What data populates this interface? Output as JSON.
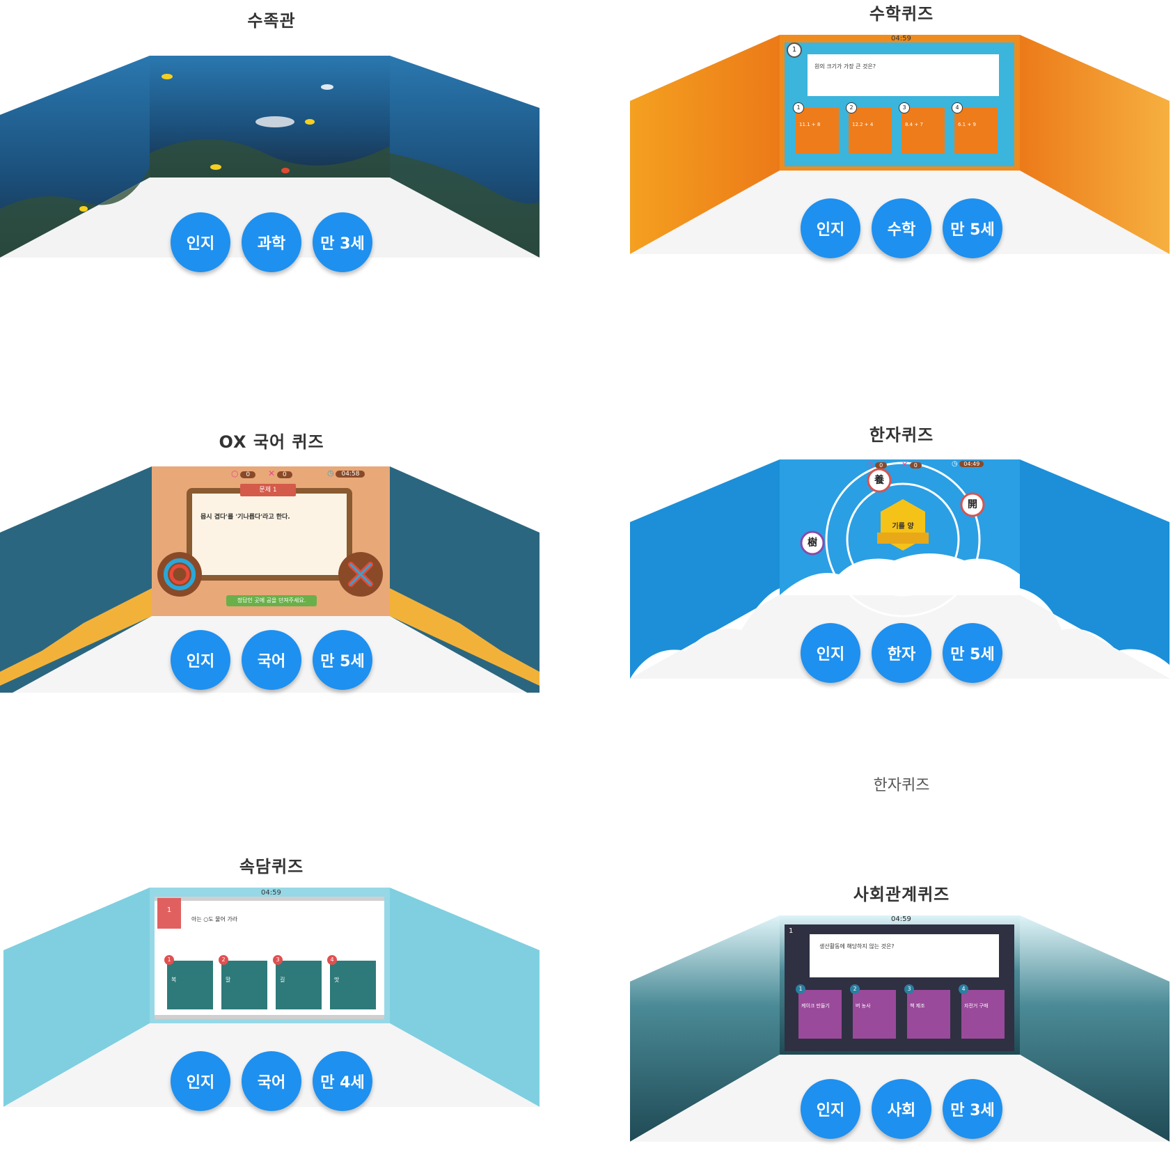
{
  "cards": [
    {
      "title": "수족관",
      "tags": [
        "인지",
        "과학",
        "만 3세"
      ],
      "colors": {
        "wall": "#1b5a8a",
        "floor": "#2a4d6e"
      }
    },
    {
      "title": "수학퀴즈",
      "tags": [
        "인지",
        "수학",
        "만 5세"
      ],
      "colors": {
        "wall": "#f08c1e",
        "panel": "#3bb5dc"
      },
      "timer": "04:59",
      "question_number": "1",
      "question": "원의 크기가 가장 큰 것은?",
      "options": [
        {
          "num": "1",
          "text": "11.1 + 8"
        },
        {
          "num": "2",
          "text": "12.2 + 4"
        },
        {
          "num": "3",
          "text": "8.4 + 7"
        },
        {
          "num": "4",
          "text": "6.1 + 9"
        }
      ]
    },
    {
      "title": "OX 국어 퀴즈",
      "tags": [
        "인지",
        "국어",
        "만 5세"
      ],
      "colors": {
        "wall": "#2b6680",
        "panel": "#e8a878"
      },
      "badge": "문제 1",
      "question": "몹시 겹다'를 '기나릅다'라고 한다.",
      "hint": "정답인 곳에 공을 던져주세요.",
      "score_o": "0",
      "score_x": "0",
      "timer": "04:58"
    },
    {
      "title": "한자퀴즈",
      "tags": [
        "인지",
        "한자",
        "만 5세"
      ],
      "colors": {
        "wall": "#1c8fd8"
      },
      "center_label": "기를 양",
      "chars": [
        "養",
        "開",
        "樹"
      ],
      "score_o": "0",
      "score_x": "0",
      "timer": "04:49"
    },
    {
      "title": "속담퀴즈",
      "tags": [
        "인지",
        "국어",
        "만 4세"
      ],
      "colors": {
        "wall": "#7fcfe0",
        "card": "#2e7a7a"
      },
      "timer": "04:59",
      "question_number": "1",
      "question": "아는 ○도 물어 가라",
      "options": [
        {
          "num": "1",
          "text": "복"
        },
        {
          "num": "2",
          "text": "말"
        },
        {
          "num": "3",
          "text": "길"
        },
        {
          "num": "4",
          "text": "맛"
        }
      ]
    },
    {
      "title": "사회관계퀴즈",
      "tags": [
        "인지",
        "사회",
        "만 3세"
      ],
      "colors": {
        "wall": "#1f5560",
        "card": "#9a4a9a"
      },
      "timer": "04:59",
      "question_number": "1",
      "question": "생산활동에 해당하지 않는 것은?",
      "options": [
        {
          "num": "1",
          "text": "케이크 만들기"
        },
        {
          "num": "2",
          "text": "버 농사"
        },
        {
          "num": "3",
          "text": "책 제조"
        },
        {
          "num": "4",
          "text": "자전거 구매"
        }
      ]
    }
  ],
  "extra_label": "한자퀴즈"
}
